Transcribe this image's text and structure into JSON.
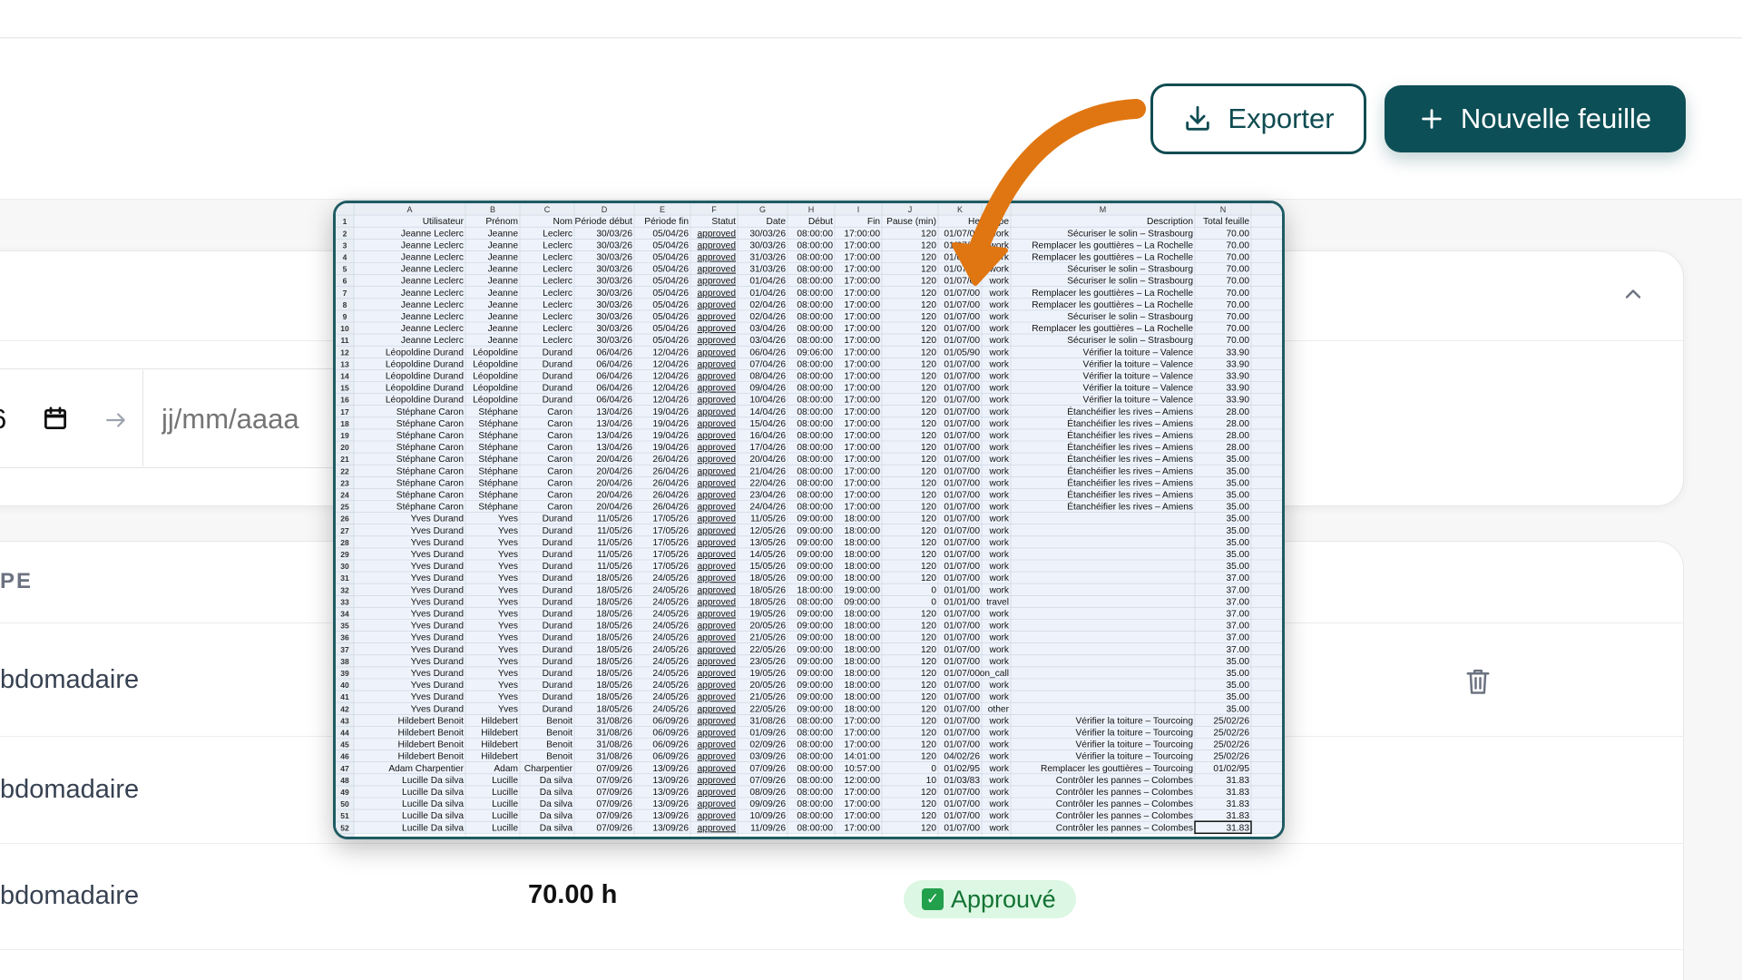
{
  "toolbar": {
    "export_label": "Exporter",
    "new_sheet_label": "Nouvelle feuille"
  },
  "filters": {
    "start_date_visible": "6",
    "end_date_placeholder": "jj/mm/aaaa"
  },
  "table": {
    "type_header": "PE",
    "rows": [
      {
        "type": "bdomadaire",
        "hours": "",
        "status": ""
      },
      {
        "type": "bdomadaire",
        "hours": "",
        "status": ""
      },
      {
        "type": "bdomadaire",
        "hours": "70.00 h",
        "status": "Approuvé"
      }
    ]
  },
  "spreadsheet": {
    "columns": [
      "A",
      "B",
      "C",
      "D",
      "E",
      "F",
      "G",
      "H",
      "I",
      "J",
      "K",
      "L",
      "M",
      "N"
    ],
    "headers": [
      "Utilisateur",
      "Prénom",
      "Nom",
      "Période début",
      "Période fin",
      "Statut",
      "Date",
      "Début",
      "Fin",
      "Pause (min)",
      "He",
      "Type",
      "Description",
      "Total feuille"
    ],
    "rows": [
      [
        "Jeanne Leclerc",
        "Jeanne",
        "Leclerc",
        "30/03/26",
        "05/04/26",
        "approved",
        "30/03/26",
        "08:00:00",
        "17:00:00",
        "120",
        "01/07/00",
        "work",
        "Sécuriser le solin – Strasbourg",
        "70.00"
      ],
      [
        "Jeanne Leclerc",
        "Jeanne",
        "Leclerc",
        "30/03/26",
        "05/04/26",
        "approved",
        "30/03/26",
        "08:00:00",
        "17:00:00",
        "120",
        "01/07/00",
        "work",
        "Remplacer les gouttières – La Rochelle",
        "70.00"
      ],
      [
        "Jeanne Leclerc",
        "Jeanne",
        "Leclerc",
        "30/03/26",
        "05/04/26",
        "approved",
        "31/03/26",
        "08:00:00",
        "17:00:00",
        "120",
        "01/07/00",
        "work",
        "Remplacer les gouttières – La Rochelle",
        "70.00"
      ],
      [
        "Jeanne Leclerc",
        "Jeanne",
        "Leclerc",
        "30/03/26",
        "05/04/26",
        "approved",
        "31/03/26",
        "08:00:00",
        "17:00:00",
        "120",
        "01/07/00",
        "work",
        "Sécuriser le solin – Strasbourg",
        "70.00"
      ],
      [
        "Jeanne Leclerc",
        "Jeanne",
        "Leclerc",
        "30/03/26",
        "05/04/26",
        "approved",
        "01/04/26",
        "08:00:00",
        "17:00:00",
        "120",
        "01/07/00",
        "work",
        "Sécuriser le solin – Strasbourg",
        "70.00"
      ],
      [
        "Jeanne Leclerc",
        "Jeanne",
        "Leclerc",
        "30/03/26",
        "05/04/26",
        "approved",
        "01/04/26",
        "08:00:00",
        "17:00:00",
        "120",
        "01/07/00",
        "work",
        "Remplacer les gouttières – La Rochelle",
        "70.00"
      ],
      [
        "Jeanne Leclerc",
        "Jeanne",
        "Leclerc",
        "30/03/26",
        "05/04/26",
        "approved",
        "02/04/26",
        "08:00:00",
        "17:00:00",
        "120",
        "01/07/00",
        "work",
        "Remplacer les gouttières – La Rochelle",
        "70.00"
      ],
      [
        "Jeanne Leclerc",
        "Jeanne",
        "Leclerc",
        "30/03/26",
        "05/04/26",
        "approved",
        "02/04/26",
        "08:00:00",
        "17:00:00",
        "120",
        "01/07/00",
        "work",
        "Sécuriser le solin – Strasbourg",
        "70.00"
      ],
      [
        "Jeanne Leclerc",
        "Jeanne",
        "Leclerc",
        "30/03/26",
        "05/04/26",
        "approved",
        "03/04/26",
        "08:00:00",
        "17:00:00",
        "120",
        "01/07/00",
        "work",
        "Remplacer les gouttières – La Rochelle",
        "70.00"
      ],
      [
        "Jeanne Leclerc",
        "Jeanne",
        "Leclerc",
        "30/03/26",
        "05/04/26",
        "approved",
        "03/04/26",
        "08:00:00",
        "17:00:00",
        "120",
        "01/07/00",
        "work",
        "Sécuriser le solin – Strasbourg",
        "70.00"
      ],
      [
        "Léopoldine Durand",
        "Léopoldine",
        "Durand",
        "06/04/26",
        "12/04/26",
        "approved",
        "06/04/26",
        "09:06:00",
        "17:00:00",
        "120",
        "01/05/90",
        "work",
        "Vérifier la toiture – Valence",
        "33.90"
      ],
      [
        "Léopoldine Durand",
        "Léopoldine",
        "Durand",
        "06/04/26",
        "12/04/26",
        "approved",
        "07/04/26",
        "08:00:00",
        "17:00:00",
        "120",
        "01/07/00",
        "work",
        "Vérifier la toiture – Valence",
        "33.90"
      ],
      [
        "Léopoldine Durand",
        "Léopoldine",
        "Durand",
        "06/04/26",
        "12/04/26",
        "approved",
        "08/04/26",
        "08:00:00",
        "17:00:00",
        "120",
        "01/07/00",
        "work",
        "Vérifier la toiture – Valence",
        "33.90"
      ],
      [
        "Léopoldine Durand",
        "Léopoldine",
        "Durand",
        "06/04/26",
        "12/04/26",
        "approved",
        "09/04/26",
        "08:00:00",
        "17:00:00",
        "120",
        "01/07/00",
        "work",
        "Vérifier la toiture – Valence",
        "33.90"
      ],
      [
        "Léopoldine Durand",
        "Léopoldine",
        "Durand",
        "06/04/26",
        "12/04/26",
        "approved",
        "10/04/26",
        "08:00:00",
        "17:00:00",
        "120",
        "01/07/00",
        "work",
        "Vérifier la toiture – Valence",
        "33.90"
      ],
      [
        "Stéphane Caron",
        "Stéphane",
        "Caron",
        "13/04/26",
        "19/04/26",
        "approved",
        "14/04/26",
        "08:00:00",
        "17:00:00",
        "120",
        "01/07/00",
        "work",
        "Étanchéifier les rives – Amiens",
        "28.00"
      ],
      [
        "Stéphane Caron",
        "Stéphane",
        "Caron",
        "13/04/26",
        "19/04/26",
        "approved",
        "15/04/26",
        "08:00:00",
        "17:00:00",
        "120",
        "01/07/00",
        "work",
        "Étanchéifier les rives – Amiens",
        "28.00"
      ],
      [
        "Stéphane Caron",
        "Stéphane",
        "Caron",
        "13/04/26",
        "19/04/26",
        "approved",
        "16/04/26",
        "08:00:00",
        "17:00:00",
        "120",
        "01/07/00",
        "work",
        "Étanchéifier les rives – Amiens",
        "28.00"
      ],
      [
        "Stéphane Caron",
        "Stéphane",
        "Caron",
        "13/04/26",
        "19/04/26",
        "approved",
        "17/04/26",
        "08:00:00",
        "17:00:00",
        "120",
        "01/07/00",
        "work",
        "Étanchéifier les rives – Amiens",
        "28.00"
      ],
      [
        "Stéphane Caron",
        "Stéphane",
        "Caron",
        "20/04/26",
        "26/04/26",
        "approved",
        "20/04/26",
        "08:00:00",
        "17:00:00",
        "120",
        "01/07/00",
        "work",
        "Étanchéifier les rives – Amiens",
        "35.00"
      ],
      [
        "Stéphane Caron",
        "Stéphane",
        "Caron",
        "20/04/26",
        "26/04/26",
        "approved",
        "21/04/26",
        "08:00:00",
        "17:00:00",
        "120",
        "01/07/00",
        "work",
        "Étanchéifier les rives – Amiens",
        "35.00"
      ],
      [
        "Stéphane Caron",
        "Stéphane",
        "Caron",
        "20/04/26",
        "26/04/26",
        "approved",
        "22/04/26",
        "08:00:00",
        "17:00:00",
        "120",
        "01/07/00",
        "work",
        "Étanchéifier les rives – Amiens",
        "35.00"
      ],
      [
        "Stéphane Caron",
        "Stéphane",
        "Caron",
        "20/04/26",
        "26/04/26",
        "approved",
        "23/04/26",
        "08:00:00",
        "17:00:00",
        "120",
        "01/07/00",
        "work",
        "Étanchéifier les rives – Amiens",
        "35.00"
      ],
      [
        "Stéphane Caron",
        "Stéphane",
        "Caron",
        "20/04/26",
        "26/04/26",
        "approved",
        "24/04/26",
        "08:00:00",
        "17:00:00",
        "120",
        "01/07/00",
        "work",
        "Étanchéifier les rives – Amiens",
        "35.00"
      ],
      [
        "Yves Durand",
        "Yves",
        "Durand",
        "11/05/26",
        "17/05/26",
        "approved",
        "11/05/26",
        "09:00:00",
        "18:00:00",
        "120",
        "01/07/00",
        "work",
        "",
        "35.00"
      ],
      [
        "Yves Durand",
        "Yves",
        "Durand",
        "11/05/26",
        "17/05/26",
        "approved",
        "12/05/26",
        "09:00:00",
        "18:00:00",
        "120",
        "01/07/00",
        "work",
        "",
        "35.00"
      ],
      [
        "Yves Durand",
        "Yves",
        "Durand",
        "11/05/26",
        "17/05/26",
        "approved",
        "13/05/26",
        "09:00:00",
        "18:00:00",
        "120",
        "01/07/00",
        "work",
        "",
        "35.00"
      ],
      [
        "Yves Durand",
        "Yves",
        "Durand",
        "11/05/26",
        "17/05/26",
        "approved",
        "14/05/26",
        "09:00:00",
        "18:00:00",
        "120",
        "01/07/00",
        "work",
        "",
        "35.00"
      ],
      [
        "Yves Durand",
        "Yves",
        "Durand",
        "11/05/26",
        "17/05/26",
        "approved",
        "15/05/26",
        "09:00:00",
        "18:00:00",
        "120",
        "01/07/00",
        "work",
        "",
        "35.00"
      ],
      [
        "Yves Durand",
        "Yves",
        "Durand",
        "18/05/26",
        "24/05/26",
        "approved",
        "18/05/26",
        "09:00:00",
        "18:00:00",
        "120",
        "01/07/00",
        "work",
        "",
        "37.00"
      ],
      [
        "Yves Durand",
        "Yves",
        "Durand",
        "18/05/26",
        "24/05/26",
        "approved",
        "18/05/26",
        "18:00:00",
        "19:00:00",
        "0",
        "01/01/00",
        "work",
        "",
        "37.00"
      ],
      [
        "Yves Durand",
        "Yves",
        "Durand",
        "18/05/26",
        "24/05/26",
        "approved",
        "18/05/26",
        "08:00:00",
        "09:00:00",
        "0",
        "01/01/00",
        "travel",
        "",
        "37.00"
      ],
      [
        "Yves Durand",
        "Yves",
        "Durand",
        "18/05/26",
        "24/05/26",
        "approved",
        "19/05/26",
        "09:00:00",
        "18:00:00",
        "120",
        "01/07/00",
        "work",
        "",
        "37.00"
      ],
      [
        "Yves Durand",
        "Yves",
        "Durand",
        "18/05/26",
        "24/05/26",
        "approved",
        "20/05/26",
        "09:00:00",
        "18:00:00",
        "120",
        "01/07/00",
        "work",
        "",
        "37.00"
      ],
      [
        "Yves Durand",
        "Yves",
        "Durand",
        "18/05/26",
        "24/05/26",
        "approved",
        "21/05/26",
        "09:00:00",
        "18:00:00",
        "120",
        "01/07/00",
        "work",
        "",
        "37.00"
      ],
      [
        "Yves Durand",
        "Yves",
        "Durand",
        "18/05/26",
        "24/05/26",
        "approved",
        "22/05/26",
        "09:00:00",
        "18:00:00",
        "120",
        "01/07/00",
        "work",
        "",
        "37.00"
      ],
      [
        "Yves Durand",
        "Yves",
        "Durand",
        "18/05/26",
        "24/05/26",
        "approved",
        "23/05/26",
        "09:00:00",
        "18:00:00",
        "120",
        "01/07/00",
        "work",
        "",
        "35.00"
      ],
      [
        "Yves Durand",
        "Yves",
        "Durand",
        "18/05/26",
        "24/05/26",
        "approved",
        "19/05/26",
        "09:00:00",
        "18:00:00",
        "120",
        "01/07/00",
        "on_call",
        "",
        "35.00"
      ],
      [
        "Yves Durand",
        "Yves",
        "Durand",
        "18/05/26",
        "24/05/26",
        "approved",
        "20/05/26",
        "09:00:00",
        "18:00:00",
        "120",
        "01/07/00",
        "work",
        "",
        "35.00"
      ],
      [
        "Yves Durand",
        "Yves",
        "Durand",
        "18/05/26",
        "24/05/26",
        "approved",
        "21/05/26",
        "09:00:00",
        "18:00:00",
        "120",
        "01/07/00",
        "work",
        "",
        "35.00"
      ],
      [
        "Yves Durand",
        "Yves",
        "Durand",
        "18/05/26",
        "24/05/26",
        "approved",
        "22/05/26",
        "09:00:00",
        "18:00:00",
        "120",
        "01/07/00",
        "other",
        "",
        "35.00"
      ],
      [
        "Hildebert Benoit",
        "Hildebert",
        "Benoit",
        "31/08/26",
        "06/09/26",
        "approved",
        "31/08/26",
        "08:00:00",
        "17:00:00",
        "120",
        "01/07/00",
        "work",
        "Vérifier la toiture – Tourcoing",
        "25/02/26"
      ],
      [
        "Hildebert Benoit",
        "Hildebert",
        "Benoit",
        "31/08/26",
        "06/09/26",
        "approved",
        "01/09/26",
        "08:00:00",
        "17:00:00",
        "120",
        "01/07/00",
        "work",
        "Vérifier la toiture – Tourcoing",
        "25/02/26"
      ],
      [
        "Hildebert Benoit",
        "Hildebert",
        "Benoit",
        "31/08/26",
        "06/09/26",
        "approved",
        "02/09/26",
        "08:00:00",
        "17:00:00",
        "120",
        "01/07/00",
        "work",
        "Vérifier la toiture – Tourcoing",
        "25/02/26"
      ],
      [
        "Hildebert Benoit",
        "Hildebert",
        "Benoit",
        "31/08/26",
        "06/09/26",
        "approved",
        "03/09/26",
        "08:00:00",
        "14:01:00",
        "120",
        "04/02/26",
        "work",
        "Vérifier la toiture – Tourcoing",
        "25/02/26"
      ],
      [
        "Adam Charpentier",
        "Adam",
        "Charpentier",
        "07/09/26",
        "13/09/26",
        "approved",
        "07/09/26",
        "08:00:00",
        "10:57:00",
        "0",
        "01/02/95",
        "work",
        "Remplacer les gouttières – Tourcoing",
        "01/02/95"
      ],
      [
        "Lucille Da silva",
        "Lucille",
        "Da silva",
        "07/09/26",
        "13/09/26",
        "approved",
        "07/09/26",
        "08:00:00",
        "12:00:00",
        "10",
        "01/03/83",
        "work",
        "Contrôler les pannes – Colombes",
        "31.83"
      ],
      [
        "Lucille Da silva",
        "Lucille",
        "Da silva",
        "07/09/26",
        "13/09/26",
        "approved",
        "08/09/26",
        "08:00:00",
        "17:00:00",
        "120",
        "01/07/00",
        "work",
        "Contrôler les pannes – Colombes",
        "31.83"
      ],
      [
        "Lucille Da silva",
        "Lucille",
        "Da silva",
        "07/09/26",
        "13/09/26",
        "approved",
        "09/09/26",
        "08:00:00",
        "17:00:00",
        "120",
        "01/07/00",
        "work",
        "Contrôler les pannes – Colombes",
        "31.83"
      ],
      [
        "Lucille Da silva",
        "Lucille",
        "Da silva",
        "07/09/26",
        "13/09/26",
        "approved",
        "10/09/26",
        "08:00:00",
        "17:00:00",
        "120",
        "01/07/00",
        "work",
        "Contrôler les pannes – Colombes",
        "31.83"
      ],
      [
        "Lucille Da silva",
        "Lucille",
        "Da silva",
        "07/09/26",
        "13/09/26",
        "approved",
        "11/09/26",
        "08:00:00",
        "17:00:00",
        "120",
        "01/07/00",
        "work",
        "Contrôler les pannes – Colombes",
        "31.83"
      ]
    ]
  },
  "colors": {
    "brand": "#0d4f56",
    "accent_arrow": "#e07611",
    "approved_bg": "#dcf7e3",
    "approved_text": "#137333"
  },
  "icons": [
    "download-icon",
    "plus-icon",
    "chevron-up-icon",
    "calendar-icon",
    "arrow-right-icon",
    "trash-icon",
    "check-icon",
    "arrow-annotation"
  ]
}
